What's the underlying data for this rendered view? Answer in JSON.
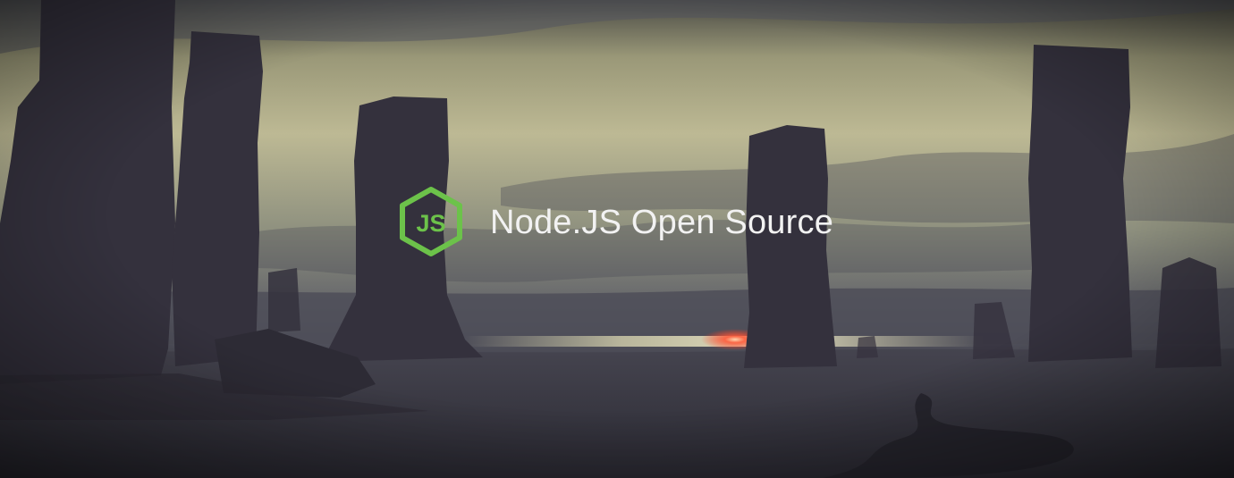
{
  "banner": {
    "logo_text": "JS",
    "title": "Node.JS Open Source"
  },
  "colors": {
    "logo_green": "#6cc24a",
    "title_white": "#f2f2f2",
    "sky_light": "#bdb994",
    "ground_dark": "#34333e",
    "sunset_red": "#ff5a3a"
  },
  "icons": {
    "logo": "nodejs-hexagon-icon"
  }
}
